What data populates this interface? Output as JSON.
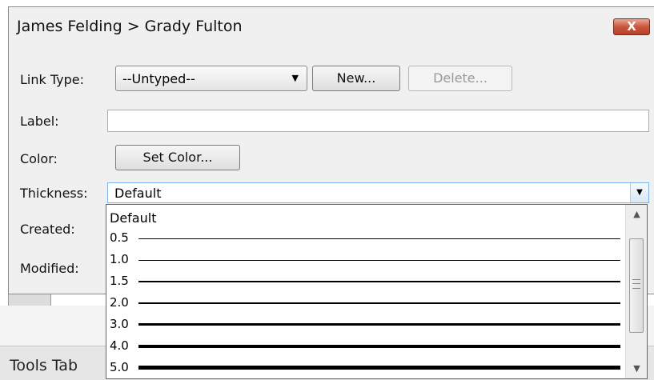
{
  "dialog": {
    "title": "James Felding > Grady Fulton",
    "close_label": "X"
  },
  "form": {
    "link_type_label": "Link Type:",
    "link_type_value": "--Untyped--",
    "new_button": "New...",
    "delete_button": "Delete...",
    "label_label": "Label:",
    "label_value": "",
    "color_label": "Color:",
    "set_color_button": "Set Color...",
    "thickness_label": "Thickness:",
    "thickness_value": "Default",
    "created_label": "Created:",
    "modified_label": "Modified:"
  },
  "thickness_options": [
    {
      "label": "Default"
    },
    {
      "label": "0.5"
    },
    {
      "label": "1.0"
    },
    {
      "label": "1.5"
    },
    {
      "label": "2.0"
    },
    {
      "label": "3.0"
    },
    {
      "label": "4.0"
    },
    {
      "label": "5.0"
    }
  ],
  "background_app": {
    "menu_text": "Tools Tab"
  },
  "icons": {
    "combo_arrow": "chevron-down-icon",
    "close": "close-icon",
    "scroll_up": "chevron-up-icon",
    "scroll_down": "chevron-down-icon"
  },
  "colors": {
    "close_button": "#c9553d",
    "select_focus_border": "#7eb4ea"
  }
}
